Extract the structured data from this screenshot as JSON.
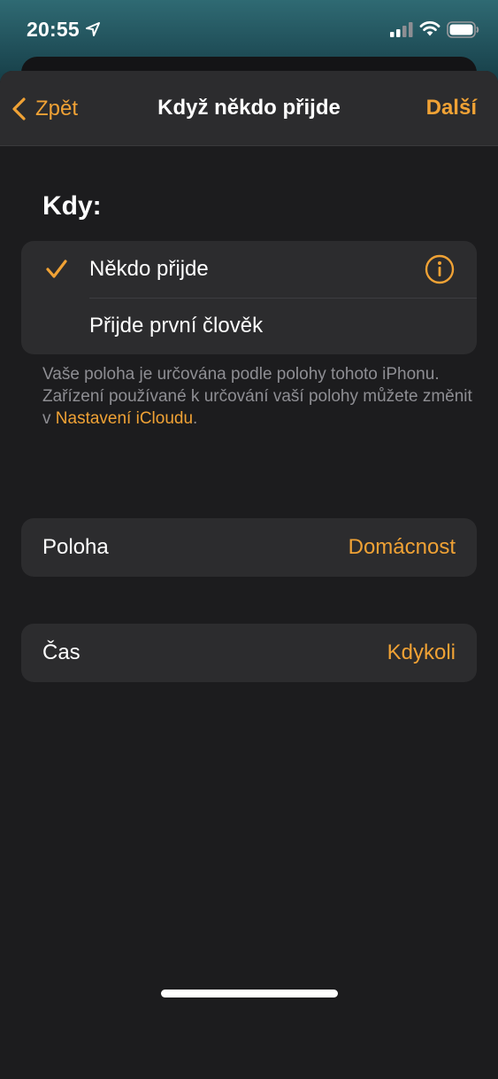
{
  "status_bar": {
    "time": "20:55"
  },
  "nav": {
    "back_label": "Zpět",
    "title": "Když někdo přijde",
    "next_label": "Další"
  },
  "when": {
    "title": "Kdy:",
    "options": [
      {
        "label": "Někdo přijde",
        "selected": true
      },
      {
        "label": "Přijde první člověk",
        "selected": false
      }
    ],
    "footnote_text": "Vaše poloha je určována podle polohy tohoto iPhonu. Zařízení používané k určování vaší polohy můžete změnit v ",
    "footnote_link": "Nastavení iCloudu",
    "footnote_end": "."
  },
  "location": {
    "label": "Poloha",
    "value": "Domácnost"
  },
  "time": {
    "label": "Čas",
    "value": "Kdykoli"
  },
  "colors": {
    "accent": "#f0a235",
    "background": "#1c1c1e",
    "cell": "#2c2c2e"
  }
}
